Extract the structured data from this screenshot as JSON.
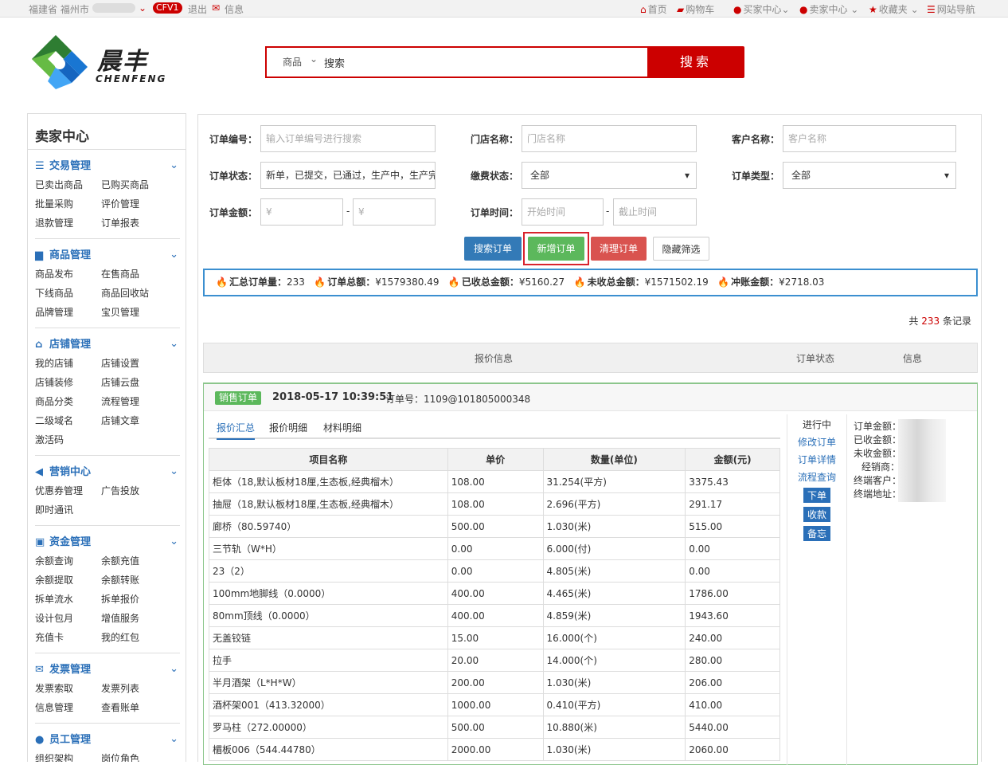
{
  "topbar": {
    "location": "福建省 福州市",
    "badge": "CFV1",
    "logout": "退出",
    "message": "信息",
    "nav": [
      {
        "icon": "home-icon",
        "glyph": "⌂",
        "label": "首页"
      },
      {
        "icon": "cart-icon",
        "glyph": "▰",
        "label": "购物车"
      },
      {
        "icon": "user-icon",
        "glyph": "●",
        "label": "买家中心⌄"
      },
      {
        "icon": "user-icon",
        "glyph": "●",
        "label": "卖家中心 ⌄"
      },
      {
        "icon": "star-icon",
        "glyph": "★",
        "label": "收藏夹 ⌄"
      },
      {
        "icon": "list-icon",
        "glyph": "☰",
        "label": "网站导航"
      }
    ]
  },
  "logo": {
    "cn": "晨丰",
    "en": "CHENFENG"
  },
  "search": {
    "category": "商品",
    "value": "搜索",
    "button": "搜索"
  },
  "sidebar": {
    "title": "卖家中心",
    "sections": [
      {
        "name": "交易管理",
        "icon": "☰",
        "links": [
          "已卖出商品",
          "已购买商品",
          "批量采购",
          "评价管理",
          "退款管理",
          "订单报表"
        ]
      },
      {
        "name": "商品管理",
        "icon": "▆",
        "links": [
          "商品发布",
          "在售商品",
          "下线商品",
          "商品回收站",
          "品牌管理",
          "宝贝管理"
        ]
      },
      {
        "name": "店铺管理",
        "icon": "⌂",
        "links": [
          "我的店铺",
          "店铺设置",
          "店铺装修",
          "店铺云盘",
          "商品分类",
          "流程管理",
          "二级域名",
          "店铺文章",
          "激活码"
        ]
      },
      {
        "name": "营销中心",
        "icon": "◀",
        "links": [
          "优惠券管理",
          "广告投放",
          "即时通讯"
        ]
      },
      {
        "name": "资金管理",
        "icon": "▣",
        "links": [
          "余额查询",
          "余额充值",
          "余额提取",
          "余额转账",
          "拆单流水",
          "拆单报价",
          "设计包月",
          "增值服务",
          "充值卡",
          "我的红包"
        ]
      },
      {
        "name": "发票管理",
        "icon": "✉",
        "links": [
          "发票索取",
          "发票列表",
          "信息管理",
          "查看账单"
        ]
      },
      {
        "name": "员工管理",
        "icon": "👥",
        "links": [
          "组织架构",
          "岗位角色"
        ]
      }
    ]
  },
  "filters": {
    "order_no": {
      "label": "订单编号：",
      "placeholder": "输入订单编号进行搜索"
    },
    "store": {
      "label": "门店名称：",
      "placeholder": "门店名称"
    },
    "customer": {
      "label": "客户名称：",
      "placeholder": "客户名称"
    },
    "status": {
      "label": "订单状态：",
      "value": "新单，已提交，已通过，生产中，生产完"
    },
    "pay": {
      "label": "缴费状态：",
      "value": "全部"
    },
    "type": {
      "label": "订单类型：",
      "value": "全部"
    },
    "amount": {
      "label": "订单金额：",
      "min": "¥",
      "max": "¥",
      "sep": "-"
    },
    "time": {
      "label": "订单时间：",
      "start": "开始时间",
      "end": "截止时间",
      "sep": "-"
    }
  },
  "buttons": {
    "search": "搜索订单",
    "add": "新增订单",
    "clear": "清理订单",
    "hide": "隐藏筛选"
  },
  "summary": [
    {
      "label": "汇总订单量：",
      "value": "233"
    },
    {
      "label": "订单总额：",
      "value": "¥1579380.49"
    },
    {
      "label": "已收总金额：",
      "value": "¥5160.27"
    },
    {
      "label": "未收总金额：",
      "value": "¥1571502.19"
    },
    {
      "label": "冲账金额：",
      "value": "¥2718.03"
    }
  ],
  "records": {
    "prefix": "共",
    "count": "233",
    "suffix": "条记录"
  },
  "list_header": {
    "quote": "报价信息",
    "status": "订单状态",
    "info": "信息"
  },
  "order": {
    "tag": "销售订单",
    "datetime": "2018-05-17 10:39:51",
    "order_no": "订单号：1109@101805000348",
    "tabs": [
      "报价汇总",
      "报价明细",
      "材料明细"
    ],
    "columns": [
      "项目名称",
      "单价",
      "数量(单位)",
      "金额(元)"
    ],
    "rows": [
      [
        "柜体（18,默认板材18厘,生态板,经典榴木）",
        "108.00",
        "31.254(平方)",
        "3375.43"
      ],
      [
        "抽屉（18,默认板材18厘,生态板,经典榴木）",
        "108.00",
        "2.696(平方)",
        "291.17"
      ],
      [
        "廊桥（80.59740）",
        "500.00",
        "1.030(米)",
        "515.00"
      ],
      [
        "三节轨（W*H）",
        "0.00",
        "6.000(付)",
        "0.00"
      ],
      [
        "23（2）",
        "0.00",
        "4.805(米)",
        "0.00"
      ],
      [
        "100mm地脚线（0.0000）",
        "400.00",
        "4.465(米)",
        "1786.00"
      ],
      [
        "80mm顶线（0.0000）",
        "400.00",
        "4.859(米)",
        "1943.60"
      ],
      [
        "无盖铰链",
        "15.00",
        "16.000(个)",
        "240.00"
      ],
      [
        "拉手",
        "20.00",
        "14.000(个)",
        "280.00"
      ],
      [
        "半月酒架（L*H*W）",
        "200.00",
        "1.030(米)",
        "206.00"
      ],
      [
        "酒杯架001（413.32000）",
        "1000.00",
        "0.410(平方)",
        "410.00"
      ],
      [
        "罗马柱（272.00000）",
        "500.00",
        "10.880(米)",
        "5440.00"
      ],
      [
        "楣板006（544.44780）",
        "2000.00",
        "1.030(米)",
        "2060.00"
      ]
    ],
    "status_text": "进行中",
    "actions": [
      "修改订单",
      "订单详情",
      "流程查询"
    ],
    "action_buttons": [
      "下单",
      "收款",
      "备忘"
    ],
    "info_labels": [
      "订单金额：",
      "已收金额：",
      "未收金额：",
      "经销商：",
      "终端客户：",
      "终端地址："
    ]
  },
  "colors": {
    "brand": "#cc0000",
    "link": "#2a6fb8",
    "primary": "#337ab7",
    "success": "#5cb85c",
    "danger": "#d9534f"
  }
}
